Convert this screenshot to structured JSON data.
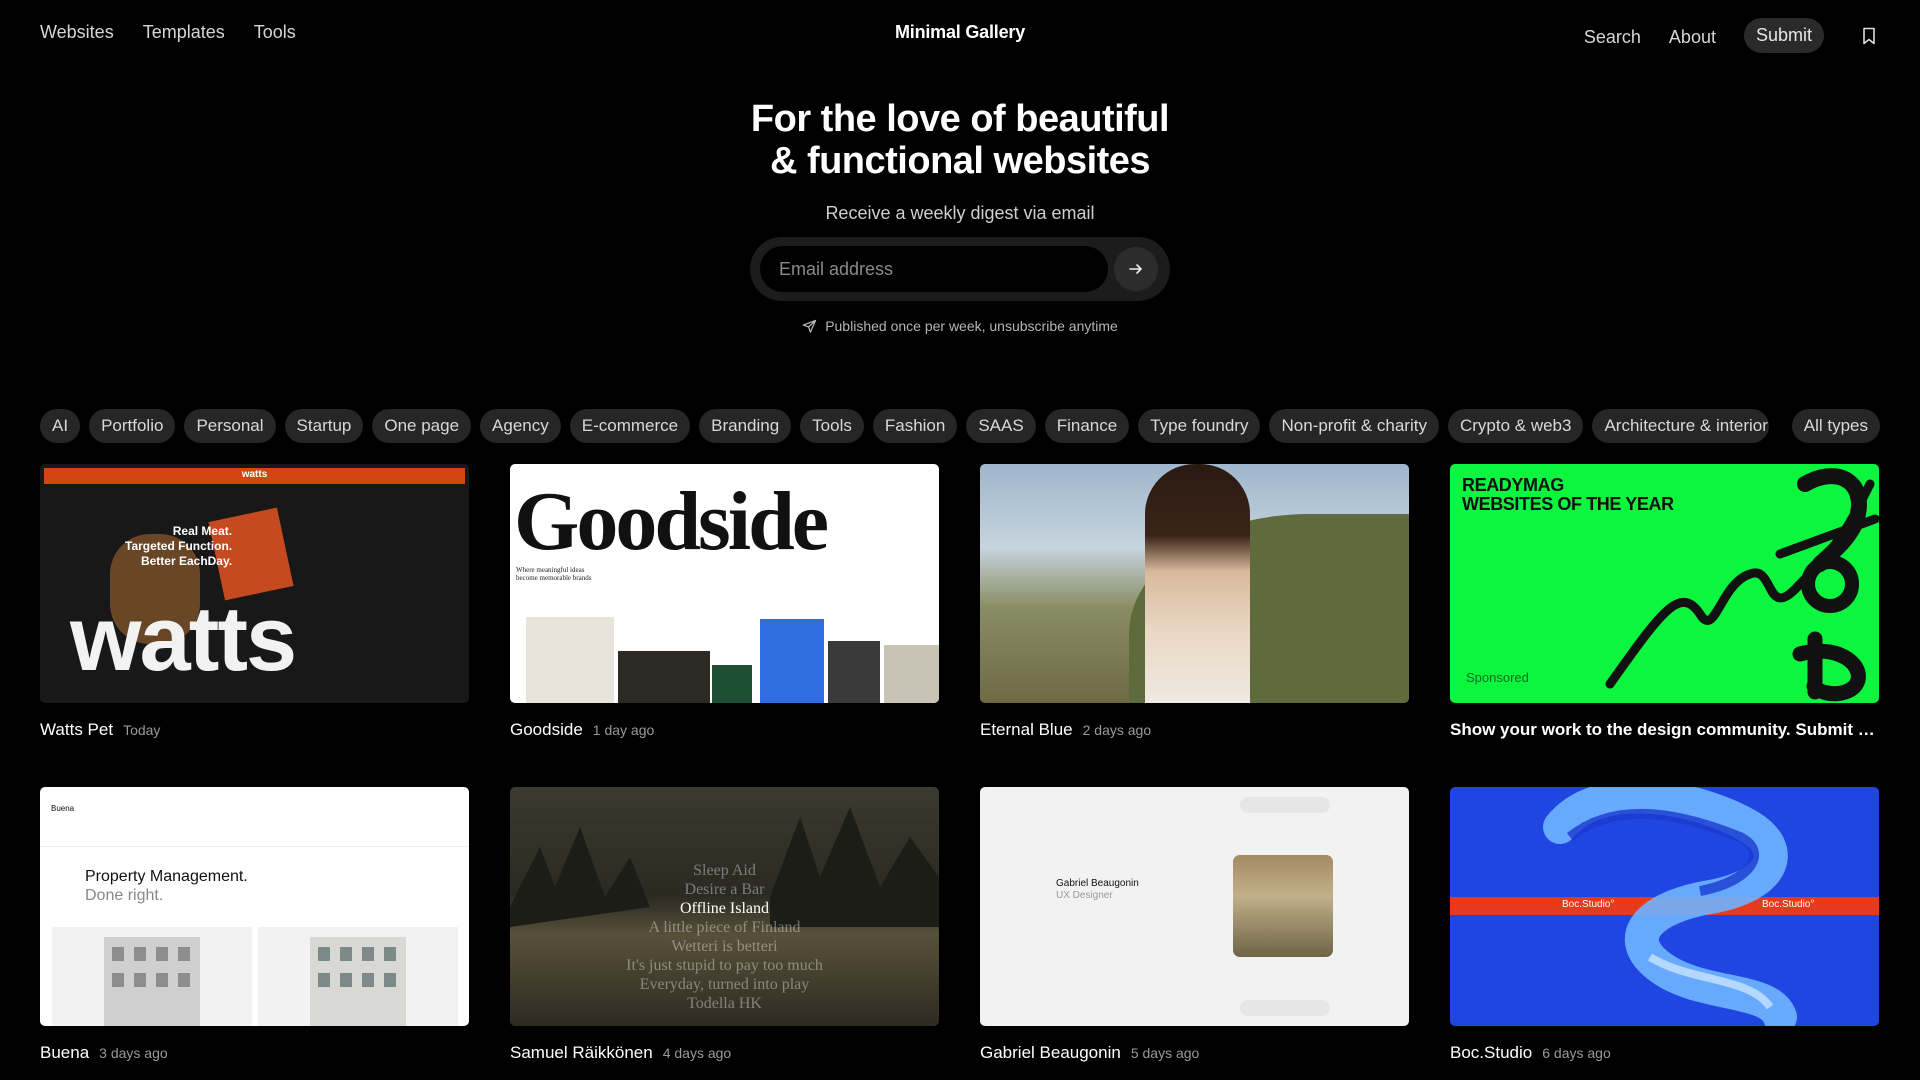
{
  "nav": {
    "left": [
      "Websites",
      "Templates",
      "Tools"
    ],
    "brand": "Minimal Gallery",
    "search": "Search",
    "about": "About",
    "submit": "Submit",
    "bookmark_icon": "bookmark-icon"
  },
  "hero": {
    "title_line1": "For the love of beautiful",
    "title_line2": "& functional websites",
    "digest": "Receive a weekly digest via email",
    "email_placeholder": "Email address",
    "note": "Published once per week, unsubscribe anytime"
  },
  "filters": [
    "AI",
    "Portfolio",
    "Personal",
    "Startup",
    "One page",
    "Agency",
    "E-commerce",
    "Branding",
    "Tools",
    "Fashion",
    "SAAS",
    "Finance",
    "Type foundry",
    "Non-profit & charity",
    "Crypto & web3",
    "Architecture & interior"
  ],
  "filter_all": "All types",
  "cards": [
    {
      "title": "Watts Pet",
      "time": "Today"
    },
    {
      "title": "Goodside",
      "time": "1 day ago"
    },
    {
      "title": "Eternal Blue",
      "time": "2 days ago"
    },
    {
      "title": "Show your work to the design community. Submit yo...",
      "time": ""
    },
    {
      "title": "Buena",
      "time": "3 days ago"
    },
    {
      "title": "Samuel Räikkönen",
      "time": "4 days ago"
    },
    {
      "title": "Gabriel Beaugonin",
      "time": "5 days ago"
    },
    {
      "title": "Boc.Studio",
      "time": "6 days ago"
    }
  ],
  "thumbs": {
    "watts_nav": "watts",
    "watts_tag": [
      "Real Meat.",
      "Targeted Function.",
      "Better EachDay."
    ],
    "watts_big": "watts",
    "goodside_word": "Goodside",
    "goodside_sub": [
      "Where meaningful ideas",
      "become memorable brands"
    ],
    "ready_title": [
      "READYMAG",
      "WEBSITES OF THE YEAR"
    ],
    "ready_sponsored": "Sponsored",
    "buena_logo": "Buena",
    "buena_pm": "Property Management.",
    "buena_done": "Done right.",
    "samuel_lines": [
      "Sleep Aid",
      "Desire a Bar",
      "Offline Island",
      "A little piece of Finland",
      "Wetteri is betteri",
      "It's just stupid to pay too much",
      "Everyday, turned into play",
      "Todella HK"
    ],
    "gabriel_name": "Gabriel Beaugonin",
    "gabriel_role": "UX Designer",
    "boc_label": "Boc.Studio°"
  },
  "colors": {
    "background": "#000000",
    "chip": "#262626",
    "ready_green": "#0bf63e",
    "watts_orange": "#d24614",
    "boc_blue": "#2046e2"
  }
}
